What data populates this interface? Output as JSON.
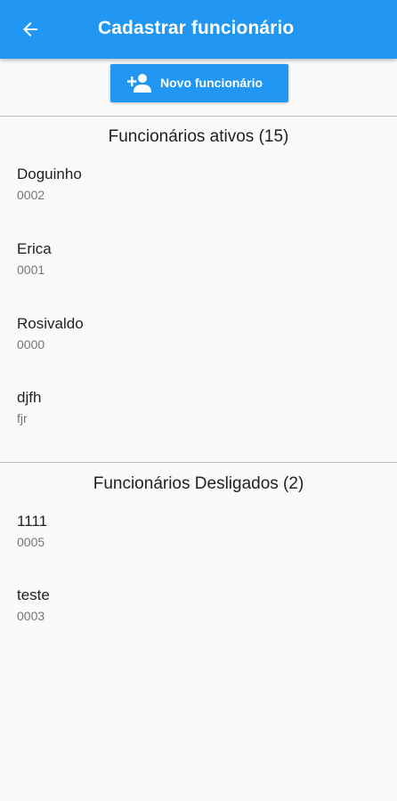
{
  "appbar": {
    "title": "Cadastrar funcionário",
    "back_icon": "arrow-left-icon",
    "color": "#2196f3"
  },
  "new_button": {
    "label": "Novo funcionário",
    "icon": "person-add-icon"
  },
  "active": {
    "title": "Funcionários ativos (15)",
    "items": [
      {
        "name": "Doguinho",
        "code": "0002"
      },
      {
        "name": "Erica",
        "code": "0001"
      },
      {
        "name": "Rosivaldo",
        "code": "0000"
      },
      {
        "name": "djfh",
        "code": "fjr"
      }
    ]
  },
  "dismissed": {
    "title": "Funcionários Desligados (2)",
    "items": [
      {
        "name": "1111",
        "code": "0005"
      },
      {
        "name": "teste",
        "code": "0003"
      }
    ]
  }
}
